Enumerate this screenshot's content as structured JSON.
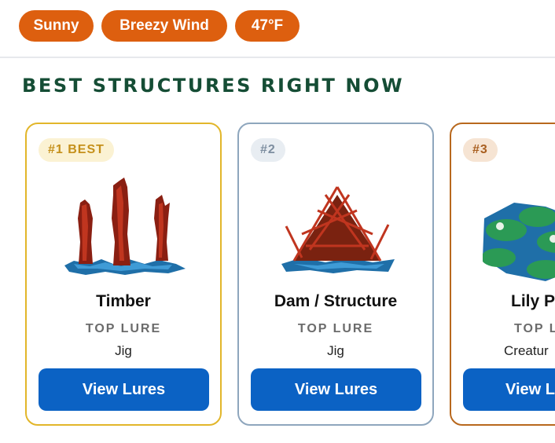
{
  "conditions": {
    "chips": [
      "Sunny",
      "Breezy Wind",
      "47°F"
    ]
  },
  "section": {
    "title": "BEST STRUCTURES RIGHT NOW"
  },
  "cards": [
    {
      "rank": "#1 BEST",
      "name": "Timber",
      "lure_heading": "TOP LURE",
      "lure": "Jig",
      "button": "View Lures",
      "image": "timber-icon"
    },
    {
      "rank": "#2",
      "name": "Dam / Structure",
      "lure_heading": "TOP LURE",
      "lure": "Jig",
      "button": "View Lures",
      "image": "dam-structure-icon"
    },
    {
      "rank": "#3",
      "name": "Lily P",
      "lure_heading": "TOP LU",
      "lure": "Creatur",
      "button": "View L",
      "image": "lily-pads-icon"
    }
  ],
  "colors": {
    "chip": "#dd5f0f",
    "title": "#154d35",
    "button": "#0b62c4",
    "rank1_border": "#e2b62a",
    "rank2_border": "#8ea6bd",
    "rank3_border": "#b8681d"
  }
}
